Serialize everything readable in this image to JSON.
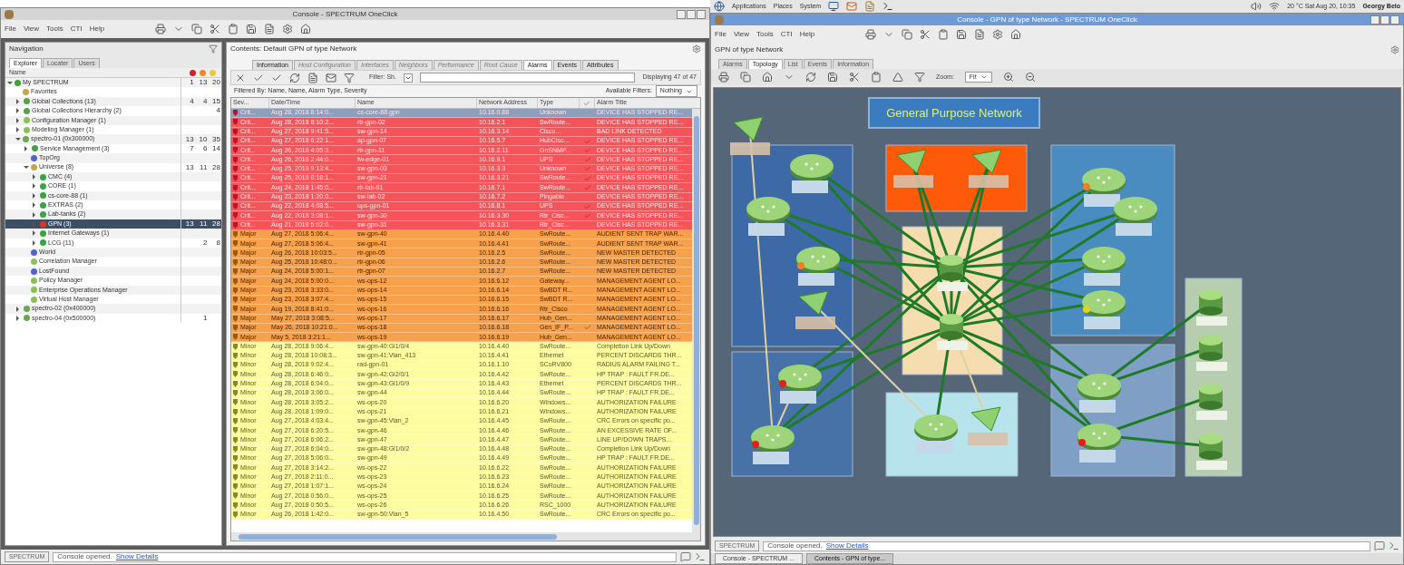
{
  "left_window": {
    "title": "Console - SPECTRUM OneClick",
    "menu": [
      "File",
      "View",
      "Tools",
      "CTI",
      "Help"
    ],
    "navigation": {
      "title": "Navigation",
      "tabs": [
        {
          "label": "Explorer",
          "selected": true
        },
        {
          "label": "Locater",
          "selected": false
        },
        {
          "label": "Users",
          "selected": false
        }
      ],
      "column": "Name",
      "tree": [
        {
          "label": "My SPECTRUM",
          "kind": "root",
          "counts": {
            "critical": "1",
            "major": "13",
            "minor": "20"
          },
          "selected": false,
          "expanded": true,
          "children": [
            {
              "label": "Favorites",
              "kind": "folder",
              "selected": false
            },
            {
              "label": "Global Collections (13)",
              "kind": "collection",
              "counts": {
                "critical": "4",
                "major": "4",
                "minor": "15"
              },
              "selected": false,
              "expanded": false
            },
            {
              "label": "Global Collections Hierarchy (2)",
              "kind": "collection",
              "counts": {
                "minor": "4"
              },
              "selected": false,
              "expanded": false
            },
            {
              "label": "Configuration Manager (1)",
              "kind": "manager",
              "selected": false,
              "expanded": false
            },
            {
              "label": "Modeling Manager (1)",
              "kind": "manager",
              "selected": false,
              "expanded": false
            },
            {
              "label": "spectro-01 (0x300000)",
              "kind": "server",
              "counts": {
                "critical": "13",
                "major": "10",
                "minor": "35"
              },
              "selected": false,
              "expanded": true,
              "children": [
                {
                  "label": "Service Management (3)",
                  "kind": "container",
                  "counts": {
                    "critical": "7",
                    "major": "6",
                    "minor": "14"
                  },
                  "selected": false,
                  "expanded": false
                },
                {
                  "label": "TopOrg",
                  "kind": "view",
                  "selected": false
                },
                {
                  "label": "Universe (8)",
                  "kind": "folder",
                  "counts": {
                    "critical": "13",
                    "major": "11",
                    "minor": "28"
                  },
                  "selected": false,
                  "expanded": true,
                  "children": [
                    {
                      "label": "CMC (4)",
                      "kind": "container",
                      "selected": false,
                      "expanded": false
                    },
                    {
                      "label": "CORE (1)",
                      "kind": "container",
                      "selected": false,
                      "expanded": false
                    },
                    {
                      "label": "cs-core-88 (1)",
                      "kind": "container",
                      "selected": false,
                      "expanded": false
                    },
                    {
                      "label": "EXTRAS (2)",
                      "kind": "container",
                      "selected": false,
                      "expanded": false
                    },
                    {
                      "label": "Lab-tanks (2)",
                      "kind": "container",
                      "selected": false,
                      "expanded": false
                    },
                    {
                      "label": "GPN (3)",
                      "kind": "network",
                      "counts": {
                        "critical": "13",
                        "major": "11",
                        "minor": "28"
                      },
                      "selected": true,
                      "expanded": false
                    },
                    {
                      "label": "Internet Gateways (1)",
                      "kind": "container",
                      "selected": false,
                      "expanded": false
                    },
                    {
                      "label": "LCG (11)",
                      "kind": "container",
                      "counts": {
                        "major": "2",
                        "minor": "8"
                      },
                      "selected": false,
                      "expanded": false
                    }
                  ]
                },
                {
                  "label": "World",
                  "kind": "view",
                  "selected": false
                },
                {
                  "label": "Correlation Manager",
                  "kind": "manager",
                  "selected": false
                },
                {
                  "label": "LostFound",
                  "kind": "view",
                  "selected": false
                },
                {
                  "label": "Policy Manager",
                  "kind": "manager",
                  "selected": false
                },
                {
                  "label": "Enterprise Operations Manager",
                  "kind": "manager",
                  "selected": false
                },
                {
                  "label": "Virtual Host Manager",
                  "kind": "manager",
                  "selected": false
                }
              ]
            },
            {
              "label": "spectro-02 (0x400000)",
              "kind": "server",
              "selected": false,
              "expanded": false
            },
            {
              "label": "spectro-04 (0x500000)",
              "kind": "server",
              "counts": {
                "major": "1"
              },
              "selected": false,
              "expanded": false
            }
          ]
        }
      ]
    },
    "contents": {
      "title": "Contents: Default GPN of type Network",
      "tabs": [
        {
          "label": "Information",
          "selected": false,
          "disabled": false
        },
        {
          "label": "Host Configuration",
          "selected": false,
          "disabled": true
        },
        {
          "label": "Interfaces",
          "selected": false,
          "disabled": true
        },
        {
          "label": "Neighbors",
          "selected": false,
          "disabled": true
        },
        {
          "label": "Performance",
          "selected": false,
          "disabled": true
        },
        {
          "label": "Root Cause",
          "selected": false,
          "disabled": true
        },
        {
          "label": "Alarms",
          "selected": true,
          "disabled": false
        },
        {
          "label": "Events",
          "selected": false,
          "disabled": false
        },
        {
          "label": "Attributes",
          "selected": false,
          "disabled": false
        }
      ],
      "filter_label": "Filter: Sh.",
      "displaying": "Displaying 47 of 47",
      "filtered_by": "Filtered By: Name, Name, Alarm Type, Severity",
      "available_label": "Available Filters:",
      "available_value": "Nothing",
      "columns": [
        "Sev...",
        "Date/Time",
        "Name",
        "Network Address",
        "Type",
        "Alarm Title"
      ],
      "rows": [
        {
          "kind": "critical",
          "sev": "Crit...",
          "time": "Aug 28, 2018 8:14:0...",
          "name": "cs-core-88.gpn",
          "address": "10.16.0.88",
          "type": "Unknown",
          "acknowledged": false,
          "selected": true,
          "title": "DEVICE HAS STOPPED RE..."
        },
        {
          "kind": "critical",
          "sev": "Crit...",
          "time": "Aug 28, 2018 8:10:2...",
          "name": "rtr-gpn-02",
          "address": "10.16.2.1",
          "type": "SwRoute...",
          "acknowledged": false,
          "selected": false,
          "title": "DEVICE HAS STOPPED RE..."
        },
        {
          "kind": "critical",
          "sev": "Crit...",
          "time": "Aug 27, 2018 9:41:5...",
          "name": "sw-gpn-14",
          "address": "10.16.3.14",
          "type": "Cisco...",
          "acknowledged": false,
          "selected": false,
          "title": "BAD LINK DETECTED"
        },
        {
          "kind": "critical",
          "sev": "Crit...",
          "time": "Aug 27, 2018 6:22:1...",
          "name": "ap-gpn-07",
          "address": "10.16.5.7",
          "type": "HubCisc...",
          "acknowledged": true,
          "selected": false,
          "title": "DEVICE HAS STOPPED RE..."
        },
        {
          "kind": "critical",
          "sev": "Crit...",
          "time": "Aug 26, 2018 4:05:3...",
          "name": "rtr-gpn-11",
          "address": "10.16.2.11",
          "type": "GnSNMP...",
          "acknowledged": true,
          "selected": false,
          "title": "DEVICE HAS STOPPED RE..."
        },
        {
          "kind": "critical",
          "sev": "Crit...",
          "time": "Aug 26, 2018 2:44:0...",
          "name": "fw-edge-01",
          "address": "10.16.9.1",
          "type": "UPS",
          "acknowledged": true,
          "selected": false,
          "title": "DEVICE HAS STOPPED RE..."
        },
        {
          "kind": "critical",
          "sev": "Crit...",
          "time": "Aug 25, 2018 9:13:4...",
          "name": "sw-gpn-03",
          "address": "10.16.3.3",
          "type": "Unknown",
          "acknowledged": true,
          "selected": false,
          "title": "DEVICE HAS STOPPED RE..."
        },
        {
          "kind": "critical",
          "sev": "Crit...",
          "time": "Aug 25, 2018 8:18:1...",
          "name": "sw-gpn-21",
          "address": "10.16.3.21",
          "type": "SwRoute...",
          "acknowledged": true,
          "selected": false,
          "title": "DEVICE HAS STOPPED RE..."
        },
        {
          "kind": "critical",
          "sev": "Crit...",
          "time": "Aug 24, 2018 1:45:0...",
          "name": "rtr-lab-01",
          "address": "10.16.7.1",
          "type": "SwRoute...",
          "acknowledged": true,
          "selected": false,
          "title": "DEVICE HAS STOPPED RE..."
        },
        {
          "kind": "critical",
          "sev": "Crit...",
          "time": "Aug 23, 2018 1:20:0...",
          "name": "sw-lab-02",
          "address": "10.16.7.2",
          "type": "Pingable",
          "acknowledged": false,
          "selected": false,
          "title": "DEVICE HAS STOPPED RE..."
        },
        {
          "kind": "critical",
          "sev": "Crit...",
          "time": "Aug 22, 2018 4:08:5...",
          "name": "ups-gpn-01",
          "address": "10.16.8.1",
          "type": "UPS",
          "acknowledged": true,
          "selected": false,
          "title": "DEVICE HAS STOPPED RE..."
        },
        {
          "kind": "critical",
          "sev": "Crit...",
          "time": "Aug 22, 2018 3:08:1...",
          "name": "sw-gpn-30",
          "address": "10.16.3.30",
          "type": "Rtr_Cisc...",
          "acknowledged": true,
          "selected": false,
          "title": "DEVICE HAS STOPPED RE..."
        },
        {
          "kind": "critical",
          "sev": "Crit...",
          "time": "Aug 21, 2018 5:02:0...",
          "name": "sw-gpn-31",
          "address": "10.16.3.31",
          "type": "Rtr_Cisc...",
          "acknowledged": false,
          "selected": false,
          "title": "DEVICE HAS STOPPED RE..."
        },
        {
          "kind": "major",
          "sev": "Major",
          "time": "Aug 27, 2018 5:06:4...",
          "name": "sw-gpn-40",
          "address": "10.16.4.40",
          "type": "SwRoute...",
          "acknowledged": false,
          "selected": false,
          "title": "AUDIENT SENT TRAP WAR..."
        },
        {
          "kind": "major",
          "sev": "Major",
          "time": "Aug 27, 2018 5:06:4...",
          "name": "sw-gpn-41",
          "address": "10.16.4.41",
          "type": "SwRoute...",
          "acknowledged": false,
          "selected": false,
          "title": "AUDIENT SENT TRAP WAR..."
        },
        {
          "kind": "major",
          "sev": "Major",
          "time": "Aug 26, 2018 10:03:5...",
          "name": "rtr-gpn-05",
          "address": "10.16.2.5",
          "type": "SwRoute...",
          "acknowledged": false,
          "selected": false,
          "title": "NEW MASTER DETECTED"
        },
        {
          "kind": "major",
          "sev": "Major",
          "time": "Aug 25, 2018 10:48:0...",
          "name": "rtr-gpn-06",
          "address": "10.16.2.6",
          "type": "SwRoute...",
          "acknowledged": false,
          "selected": false,
          "title": "NEW MASTER DETECTED"
        },
        {
          "kind": "major",
          "sev": "Major",
          "time": "Aug 24, 2018 5:00:1...",
          "name": "rtr-gpn-07",
          "address": "10.16.2.7",
          "type": "SwRoute...",
          "acknowledged": false,
          "selected": false,
          "title": "NEW MASTER DETECTED"
        },
        {
          "kind": "major",
          "sev": "Major",
          "time": "Aug 24, 2018 5:00:0...",
          "name": "ws-ops-12",
          "address": "10.16.6.12",
          "type": "Gateway...",
          "acknowledged": false,
          "selected": false,
          "title": "MANAGEMENT AGENT LO..."
        },
        {
          "kind": "major",
          "sev": "Major",
          "time": "Aug 23, 2018 3:33:0...",
          "name": "ws-ops-14",
          "address": "10.16.6.14",
          "type": "SwBDT R...",
          "acknowledged": false,
          "selected": false,
          "title": "MANAGEMENT AGENT LO..."
        },
        {
          "kind": "major",
          "sev": "Major",
          "time": "Aug 23, 2018 3:07:4...",
          "name": "ws-ops-15",
          "address": "10.16.6.15",
          "type": "SwBDT R...",
          "acknowledged": false,
          "selected": false,
          "title": "MANAGEMENT AGENT LO..."
        },
        {
          "kind": "major",
          "sev": "Major",
          "time": "Aug 19, 2018 8:41:0...",
          "name": "ws-ops-16",
          "address": "10.16.6.16",
          "type": "Rtr_Cisco",
          "acknowledged": false,
          "selected": false,
          "title": "MANAGEMENT AGENT LO..."
        },
        {
          "kind": "major",
          "sev": "Major",
          "time": "May 27, 2018 3:08:5...",
          "name": "ws-ops-17",
          "address": "10.16.6.17",
          "type": "Hub_Gen...",
          "acknowledged": false,
          "selected": false,
          "title": "MANAGEMENT AGENT LO..."
        },
        {
          "kind": "major",
          "sev": "Major",
          "time": "May 26, 2018 10:21:0...",
          "name": "ws-ops-18",
          "address": "10.16.6.18",
          "type": "Gen_IF_P...",
          "acknowledged": true,
          "selected": false,
          "title": "MANAGEMENT AGENT LO..."
        },
        {
          "kind": "major",
          "sev": "Major",
          "time": "May 5, 2018 3:21:1...",
          "name": "ws-ops-19",
          "address": "10.16.6.19",
          "type": "Hub_Gen...",
          "acknowledged": false,
          "selected": false,
          "title": "MANAGEMENT AGENT LO..."
        },
        {
          "kind": "minor",
          "sev": "Minor",
          "time": "Aug 28, 2018 9:06:4...",
          "name": "sw-gpn-40:Gi1/0/4",
          "address": "10.16.4.40",
          "type": "SwRoute...",
          "acknowledged": false,
          "selected": false,
          "title": "Completion Link Up/Down"
        },
        {
          "kind": "minor",
          "sev": "Minor",
          "time": "Aug 28, 2018 10:08:3...",
          "name": "sw-gpn-41:Vlan_413",
          "address": "10.16.4.41",
          "type": "Ethernet",
          "acknowledged": false,
          "selected": false,
          "title": "PERCENT DISCARDS THR..."
        },
        {
          "kind": "minor",
          "sev": "Minor",
          "time": "Aug 28, 2018 9:02:4...",
          "name": "rad-gpn-01",
          "address": "10.16.1.10",
          "type": "SCoRV800",
          "acknowledged": false,
          "selected": false,
          "title": "RADIUS ALARM FAILING T..."
        },
        {
          "kind": "minor",
          "sev": "Minor",
          "time": "Aug 28, 2018 6:46:0...",
          "name": "sw-gpn-42:Gi2/0/1",
          "address": "10.16.4.42",
          "type": "SwRoute...",
          "acknowledged": false,
          "selected": false,
          "title": "HP TRAP : FAULT FR.DE..."
        },
        {
          "kind": "minor",
          "sev": "Minor",
          "time": "Aug 28, 2018 6:04:0...",
          "name": "sw-gpn-43:Gi1/0/9",
          "address": "10.16.4.43",
          "type": "Ethernet",
          "acknowledged": false,
          "selected": false,
          "title": "PERCENT DISCARDS THR..."
        },
        {
          "kind": "minor",
          "sev": "Minor",
          "time": "Aug 28, 2018 3:06:0...",
          "name": "sw-gpn-44",
          "address": "10.16.4.44",
          "type": "SwRoute...",
          "acknowledged": false,
          "selected": false,
          "title": "HP TRAP : FAULT FR.DE..."
        },
        {
          "kind": "minor",
          "sev": "Minor",
          "time": "Aug 28, 2018 3:05:2...",
          "name": "ws-ops-20",
          "address": "10.16.6.20",
          "type": "Windows...",
          "acknowledged": false,
          "selected": false,
          "title": "AUTHORIZATION FAILURE"
        },
        {
          "kind": "minor",
          "sev": "Minor",
          "time": "Aug 28, 2018 1:09:0...",
          "name": "ws-ops-21",
          "address": "10.16.6.21",
          "type": "Windows...",
          "acknowledged": false,
          "selected": false,
          "title": "AUTHORIZATION FAILURE"
        },
        {
          "kind": "minor",
          "sev": "Minor",
          "time": "Aug 27, 2018 4:03:4...",
          "name": "sw-gpn-45:Vlan_2",
          "address": "10.16.4.45",
          "type": "SwRoute...",
          "acknowledged": false,
          "selected": false,
          "title": "CRC Errors on specific po..."
        },
        {
          "kind": "minor",
          "sev": "Minor",
          "time": "Aug 27, 2018 6:20:5...",
          "name": "sw-gpn-46",
          "address": "10.16.4.46",
          "type": "SwRoute...",
          "acknowledged": false,
          "selected": false,
          "title": "AN EXCESSIVE RATE OF..."
        },
        {
          "kind": "minor",
          "sev": "Minor",
          "time": "Aug 27, 2018 6:06:2...",
          "name": "sw-gpn-47",
          "address": "10.16.4.47",
          "type": "SwRoute...",
          "acknowledged": false,
          "selected": false,
          "title": "LINE UP/DOWN TRAPS..."
        },
        {
          "kind": "minor",
          "sev": "Minor",
          "time": "Aug 27, 2018 6:04:0...",
          "name": "sw-gpn-48:Gi1/0/2",
          "address": "10.16.4.48",
          "type": "SwRoute...",
          "acknowledged": false,
          "selected": false,
          "title": "Completion Link Up/Down"
        },
        {
          "kind": "minor",
          "sev": "Minor",
          "time": "Aug 27, 2018 5:06:0...",
          "name": "sw-gpn-49",
          "address": "10.16.4.49",
          "type": "SwRoute...",
          "acknowledged": false,
          "selected": false,
          "title": "HP TRAP : FAULT FR.DE..."
        },
        {
          "kind": "minor",
          "sev": "Minor",
          "time": "Aug 27, 2018 3:14:2...",
          "name": "ws-ops-22",
          "address": "10.16.6.22",
          "type": "SwRoute...",
          "acknowledged": false,
          "selected": false,
          "title": "AUTHORIZATION FAILURE"
        },
        {
          "kind": "minor",
          "sev": "Minor",
          "time": "Aug 27, 2018 2:11:0...",
          "name": "ws-ops-23",
          "address": "10.16.6.23",
          "type": "SwRoute...",
          "acknowledged": false,
          "selected": false,
          "title": "AUTHORIZATION FAILURE"
        },
        {
          "kind": "minor",
          "sev": "Minor",
          "time": "Aug 27, 2018 1:07:1...",
          "name": "ws-ops-24",
          "address": "10.16.6.24",
          "type": "SwRoute...",
          "acknowledged": false,
          "selected": false,
          "title": "AUTHORIZATION FAILURE"
        },
        {
          "kind": "minor",
          "sev": "Minor",
          "time": "Aug 27, 2018 0:56:0...",
          "name": "ws-ops-25",
          "address": "10.16.6.25",
          "type": "SwRoute...",
          "acknowledged": false,
          "selected": false,
          "title": "AUTHORIZATION FAILURE"
        },
        {
          "kind": "minor",
          "sev": "Minor",
          "time": "Aug 27, 2018 0:50:5...",
          "name": "ws-ops-26",
          "address": "10.16.6.26",
          "type": "RSC_1000",
          "acknowledged": false,
          "selected": false,
          "title": "AUTHORIZATION FAILURE"
        },
        {
          "kind": "minor",
          "sev": "Minor",
          "time": "Aug 26, 2018 1:42:0...",
          "name": "sw-gpn-50:Vlan_5",
          "address": "10.16.4.50",
          "type": "SwRoute...",
          "acknowledged": false,
          "selected": false,
          "title": "CRC Errors on specific po..."
        }
      ]
    },
    "status": {
      "label": "SPECTRUM",
      "message": "Console opened.",
      "link": "Show Details"
    }
  },
  "right_window": {
    "panel_menu": [
      "Applications",
      "Places",
      "System"
    ],
    "panel_status": "20 °C  Sat Aug 20, 10:35",
    "panel_user": "Georgy Belo",
    "title": "Console - GPN of type Network - SPECTRUM OneClick",
    "menu": [
      "File",
      "View",
      "Tools",
      "CTI",
      "Help"
    ],
    "header": "GPN of type Network",
    "tabs": [
      {
        "label": "Alarms",
        "selected": false
      },
      {
        "label": "Topology",
        "selected": true
      },
      {
        "label": "List",
        "selected": false
      },
      {
        "label": "Events",
        "selected": false
      },
      {
        "label": "Information",
        "selected": false
      }
    ],
    "zoom_label": "Zoom:",
    "zoom_value": "Fit",
    "topology": {
      "title": "General Purpose Network",
      "groups": [
        {
          "color": "#3d6aa6"
        },
        {
          "color": "#4672a8"
        },
        {
          "color": "#ff5a0a"
        },
        {
          "color": "#f6ddb0"
        },
        {
          "color": "#b7e4ec"
        },
        {
          "color": "#4a8cc0"
        },
        {
          "color": "#7f9fc4"
        },
        {
          "color": "#b6cdb0"
        }
      ],
      "nodes": [
        {
          "kind": "wireless"
        },
        {
          "kind": "router"
        },
        {
          "kind": "router"
        },
        {
          "kind": "router",
          "color": "#f08020"
        },
        {
          "kind": "wireless"
        },
        {
          "kind": "router",
          "color": "#e0201a"
        },
        {
          "kind": "router",
          "color": "#e0201a"
        },
        {
          "kind": "wireless"
        },
        {
          "kind": "wireless"
        },
        {
          "kind": "switch"
        },
        {
          "kind": "switch"
        },
        {
          "kind": "router"
        },
        {
          "kind": "wireless"
        },
        {
          "kind": "router",
          "color": "#f08020"
        },
        {
          "kind": "router"
        },
        {
          "kind": "router"
        },
        {
          "kind": "router",
          "color": "#e8d020"
        },
        {
          "kind": "router"
        },
        {
          "kind": "router",
          "color": "#e0201a"
        },
        {
          "kind": "switch"
        },
        {
          "kind": "switch"
        },
        {
          "kind": "switch"
        },
        {
          "kind": "switch"
        }
      ]
    },
    "status": {
      "label": "SPECTRUM",
      "message": "Console opened.",
      "link": "Show Details"
    },
    "taskbar": [
      {
        "label": "Console - SPECTRUM ...",
        "selected": false
      },
      {
        "label": "Contents - GPN of type...",
        "selected": true
      }
    ]
  }
}
